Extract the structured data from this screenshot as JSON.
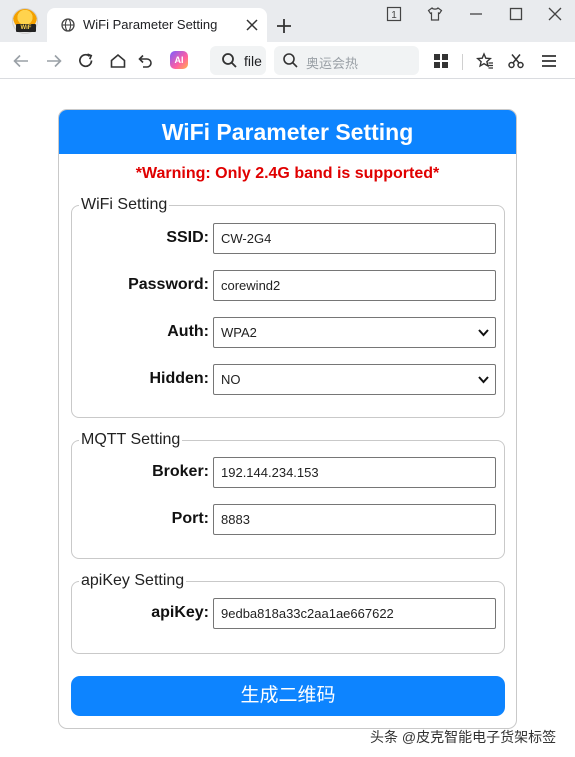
{
  "browser": {
    "tab_title": "WiFi Parameter Setting",
    "logo_badge": "WiF",
    "address_text": "file",
    "search_placeholder": "奥运会热",
    "ai_label": "AI",
    "tab_counter": "1"
  },
  "page": {
    "title": "WiFi Parameter Setting",
    "warning": "*Warning: Only 2.4G band is supported*",
    "wifi": {
      "legend": "WiFi Setting",
      "ssid_label": "SSID:",
      "ssid_value": "CW-2G4",
      "password_label": "Password:",
      "password_value": "corewind2",
      "auth_label": "Auth:",
      "auth_value": "WPA2",
      "hidden_label": "Hidden:",
      "hidden_value": "NO"
    },
    "mqtt": {
      "legend": "MQTT Setting",
      "broker_label": "Broker:",
      "broker_value": "192.144.234.153",
      "port_label": "Port:",
      "port_value": "8883"
    },
    "apikey": {
      "legend": "apiKey Setting",
      "apikey_label": "apiKey:",
      "apikey_value": "9edba818a33c2aa1ae667622"
    },
    "generate_button": "生成二维码"
  },
  "watermark": "头条 @皮克智能电子货架标签",
  "colors": {
    "accent": "#0d84ff",
    "warning": "#e00000"
  }
}
